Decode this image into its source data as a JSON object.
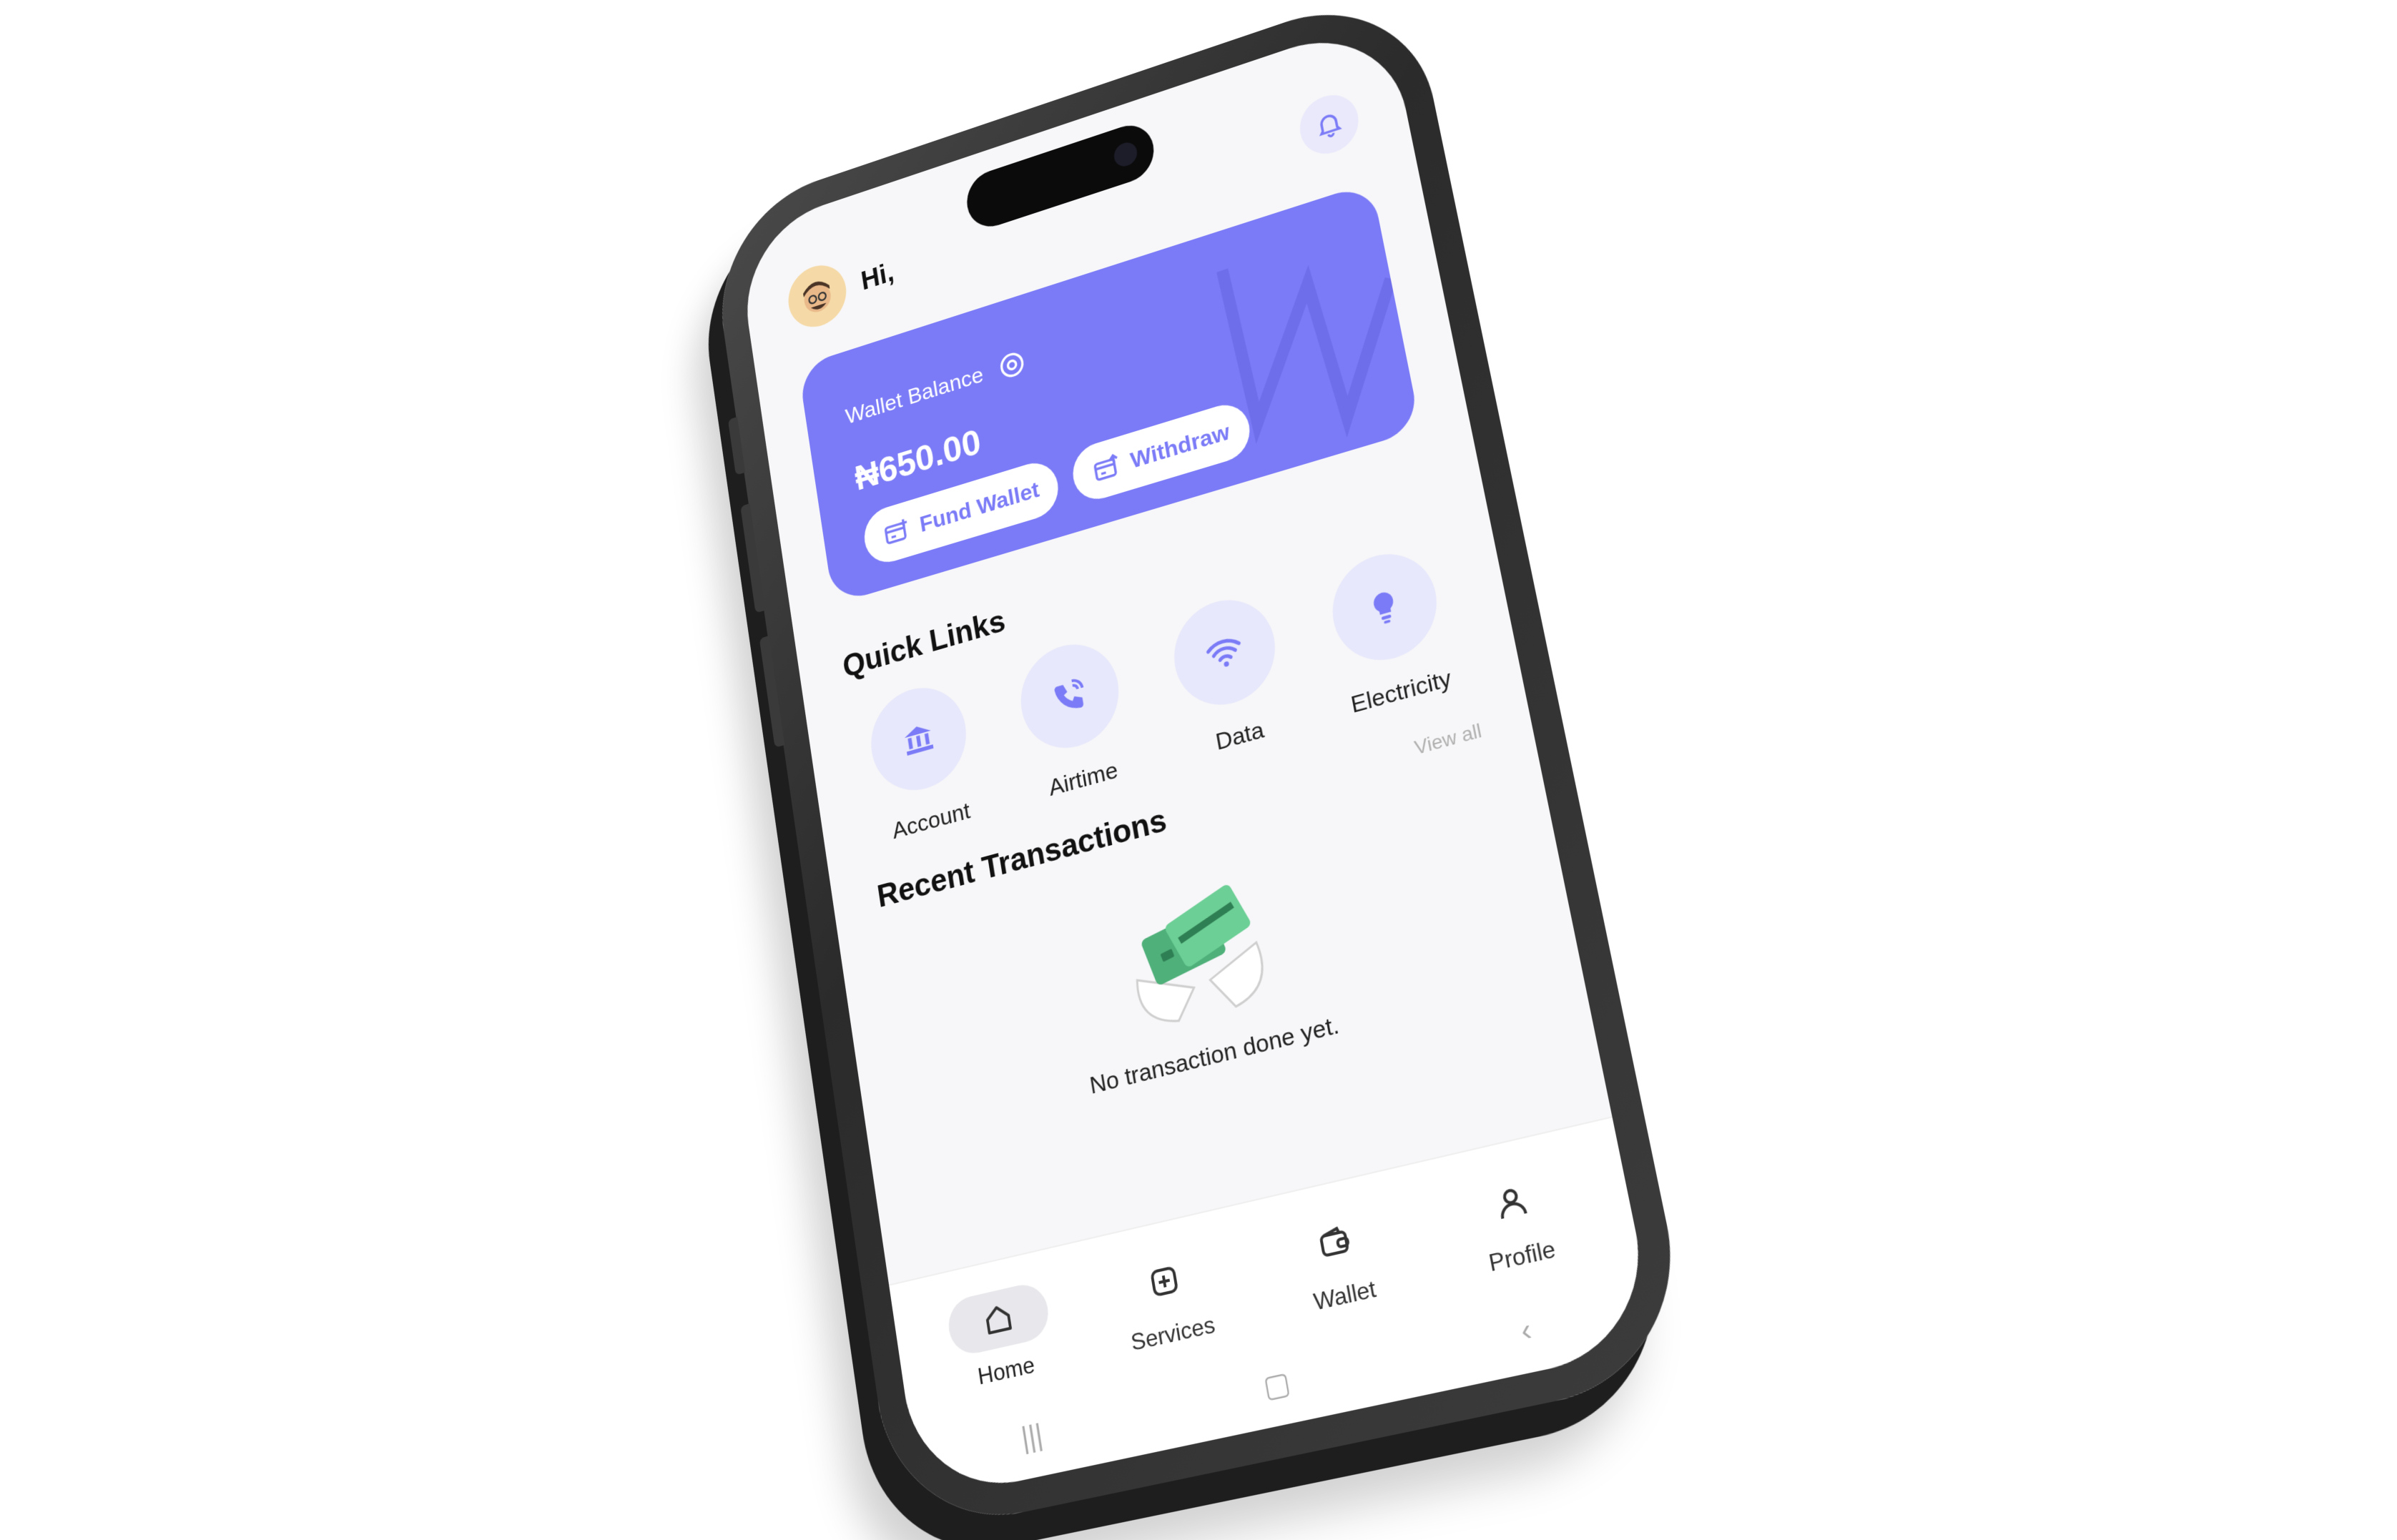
{
  "header": {
    "greeting": "Hi,"
  },
  "wallet": {
    "title": "Wallet Balance",
    "amount": "₦650.00",
    "fund_label": "Fund Wallet",
    "withdraw_label": "Withdraw"
  },
  "quick_links": {
    "title": "Quick Links",
    "items": [
      {
        "label": "Account",
        "icon": "bank-icon"
      },
      {
        "label": "Airtime",
        "icon": "phone-icon"
      },
      {
        "label": "Data",
        "icon": "wifi-icon"
      },
      {
        "label": "Electricity",
        "icon": "bulb-icon"
      }
    ]
  },
  "recent": {
    "title": "Recent Transactions",
    "view_all": "View all",
    "empty_text": "No transaction done yet."
  },
  "tabbar": {
    "items": [
      {
        "label": "Home",
        "icon": "home-icon"
      },
      {
        "label": "Services",
        "icon": "plus-square-icon"
      },
      {
        "label": "Wallet",
        "icon": "wallet-icon"
      },
      {
        "label": "Profile",
        "icon": "user-icon"
      }
    ]
  },
  "colors": {
    "accent": "#7b7bf7",
    "accent_light": "#e7e8fb"
  }
}
